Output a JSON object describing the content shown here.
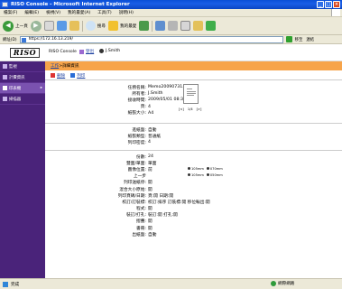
{
  "window": {
    "title": "RISO Console - Microsoft Internet Explorer",
    "buttons": [
      "_",
      "□",
      "×"
    ]
  },
  "menubar": {
    "items": [
      "檔案(F)",
      "編輯(E)",
      "檢視(V)",
      "我的最愛(A)",
      "工具(T)",
      "說明(H)"
    ]
  },
  "toolbar": {
    "back_label": "上一頁",
    "search_label": "搜尋",
    "favorites_label": "我的最愛"
  },
  "address": {
    "label": "網址(D)",
    "url": "https://172.16.13.219/",
    "go_label": "移至",
    "links_label": "連結"
  },
  "app": {
    "logo_text": "RISO",
    "app_name": "RISO Console",
    "logout_label": "登出",
    "user_label": "J.Smith"
  },
  "sidebar": {
    "items": [
      {
        "label": "監視"
      },
      {
        "label": "計費資訊"
      },
      {
        "label": "印表機"
      },
      {
        "label": "掃描器"
      }
    ]
  },
  "breadcrumb": {
    "link": "工作",
    "separator": " > ",
    "current": "詳細資訊"
  },
  "actions": {
    "delete_label": "刪除",
    "print_label": "列印"
  },
  "details": {
    "job_name_label": "任務名稱:",
    "job_name": "Memo20090731.doc",
    "owner_label": "所有者:",
    "owner": "J.Smith",
    "received_label": "接收時間:",
    "received": "2009/05/01 08:35",
    "pages_label": "頁:",
    "pages": "4",
    "paper_size_label": "紙張大小:",
    "paper_size": "A4",
    "thumb_nav": [
      "[<]",
      "1/4",
      "[>]"
    ]
  },
  "paper": {
    "tray_label": "進紙盤:",
    "tray": "自動",
    "type_label": "紙張類型:",
    "type": "普通紙",
    "density_label": "列印密度:",
    "density": "4"
  },
  "settings": {
    "copies_label": "份數:",
    "copies": "24",
    "duplex_label": "雙面/單面:",
    "duplex": "單面",
    "image_pos_label": "圖像位置:",
    "image_pos": "前",
    "image_pos_opt1": "105mm",
    "image_pos_opt2": "070mm",
    "step_label": "上一步",
    "step_opt1": "105mm",
    "step_opt2": "050mm",
    "tray_select_label": "列印送紙停:",
    "tray_select": "開",
    "mixed_size_label": "混合大小原始:",
    "mixed_size": "開",
    "print_date_label": "列印頁碼/日期:",
    "print_date": "頁:開 日期:開",
    "collate_label": "校訂/訂裝標:",
    "collate": "校訂:排序 訂裝標:開 移位輸出:開",
    "program_label": "程式:",
    "program": "開",
    "staple_label": "裝訂/打孔:",
    "staple": "裝訂:開 打孔:開",
    "fold_label": "摺疊:",
    "fold": "開",
    "booklet_label": "書冊:",
    "booklet": "開",
    "output_tray_label": "出紙盤:",
    "output_tray": "自動"
  },
  "status": {
    "text": "完成",
    "zone": "網際網路"
  },
  "colors": {
    "sidebar_bg": "#4a237a",
    "breadcrumb_bg": "#f7a44a",
    "titlebar": "#0a4fd6"
  }
}
